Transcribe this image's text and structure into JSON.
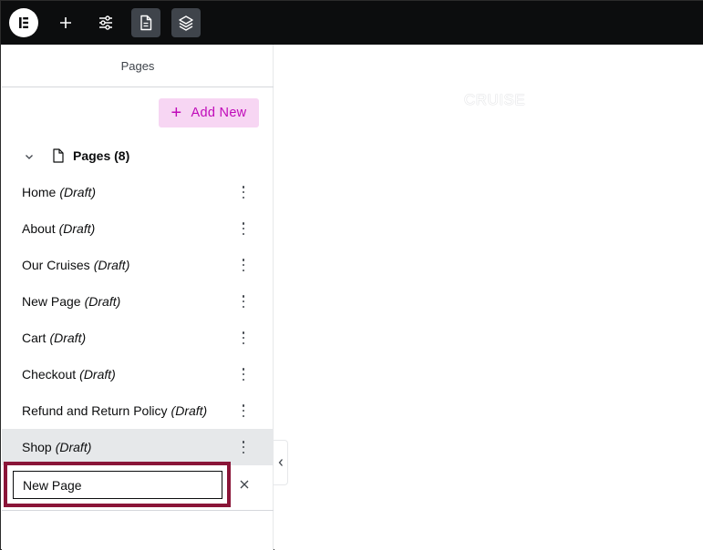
{
  "topbar": {
    "logo_icon": "elementor-logo-icon",
    "buttons": [
      {
        "name": "add-element",
        "icon": "plus-icon"
      },
      {
        "name": "site-settings",
        "icon": "sliders-icon"
      },
      {
        "name": "pages",
        "icon": "document-icon",
        "active": true
      },
      {
        "name": "structure",
        "icon": "layers-icon",
        "active": true
      }
    ]
  },
  "panel": {
    "title": "Pages",
    "add_new_label": "Add New",
    "group_label": "Pages (8)",
    "pages": [
      {
        "title": "Home",
        "status": "(Draft)"
      },
      {
        "title": "About",
        "status": "(Draft)"
      },
      {
        "title": "Our Cruises",
        "status": "(Draft)"
      },
      {
        "title": "New Page",
        "status": "(Draft)"
      },
      {
        "title": "Cart",
        "status": "(Draft)"
      },
      {
        "title": "Checkout",
        "status": "(Draft)"
      },
      {
        "title": "Refund and Return Policy",
        "status": "(Draft)"
      },
      {
        "title": "Shop",
        "status": "(Draft)",
        "selected": true
      }
    ],
    "new_page_input_value": "New Page"
  },
  "canvas": {
    "text": "CRUISE"
  },
  "colors": {
    "topbar": "#0c0d0e",
    "accent": "#c00bb9",
    "accent_bg": "#f7d6f3",
    "highlight": "#8a1538",
    "selected_row": "#e6e8ea"
  }
}
